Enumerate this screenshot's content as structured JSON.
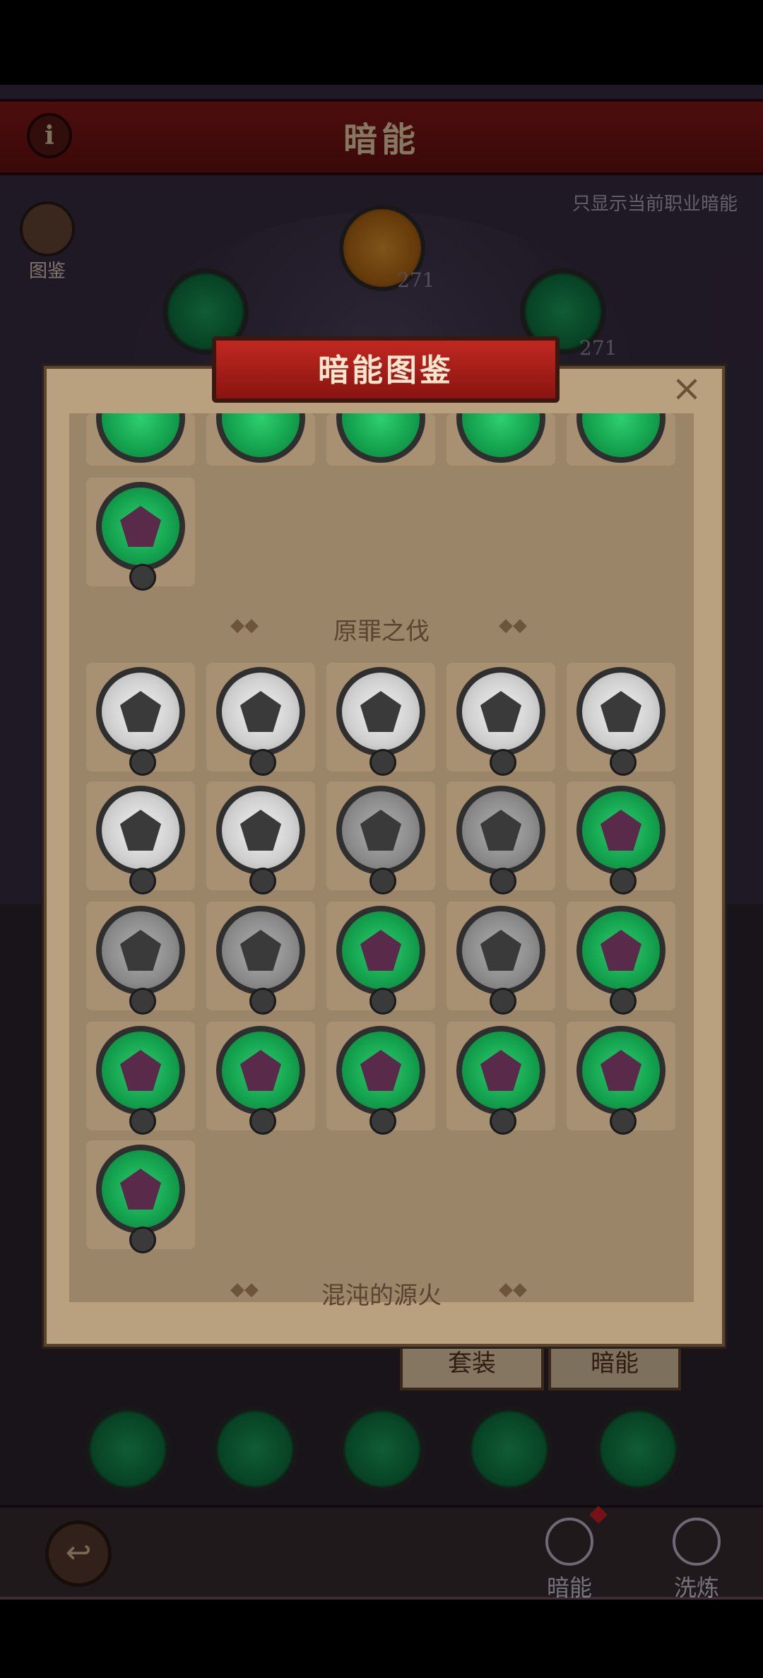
{
  "background": {
    "title": "暗能",
    "info_icon": "info-icon",
    "filter_text": "只显示当前职业暗能",
    "codex_label": "图鉴",
    "counts": [
      "271",
      "271"
    ],
    "tabs": {
      "set": "套装",
      "dark_energy": "暗能"
    },
    "nav": [
      {
        "label": "暗能",
        "icon": "dark-energy-icon",
        "has_alert": true
      },
      {
        "label": "洗炼",
        "icon": "refine-icon",
        "has_alert": false
      }
    ]
  },
  "modal": {
    "title": "暗能图鉴",
    "close_icon": "close-icon",
    "sections": [
      {
        "title": "原罪之伐"
      },
      {
        "title": "混沌的源火"
      }
    ]
  },
  "colors": {
    "banner_red": "#b02018",
    "parchment": "#b9a17f",
    "slot": "#a89072",
    "owned_green": "#13a04d",
    "unowned_silver": "#cfcfcf",
    "unowned_gray": "#8a8a8a"
  },
  "grid": {
    "top_partial_row": [
      "green",
      "green",
      "green",
      "green",
      "green"
    ],
    "prev_section_last": [
      "green"
    ],
    "original_sin": [
      [
        "silver",
        "silver",
        "silver",
        "silver",
        "silver"
      ],
      [
        "silver",
        "silver",
        "gray",
        "gray",
        "green"
      ],
      [
        "gray",
        "gray",
        "green",
        "gray",
        "green"
      ],
      [
        "green",
        "green",
        "green",
        "green",
        "green"
      ],
      [
        "green"
      ]
    ]
  }
}
